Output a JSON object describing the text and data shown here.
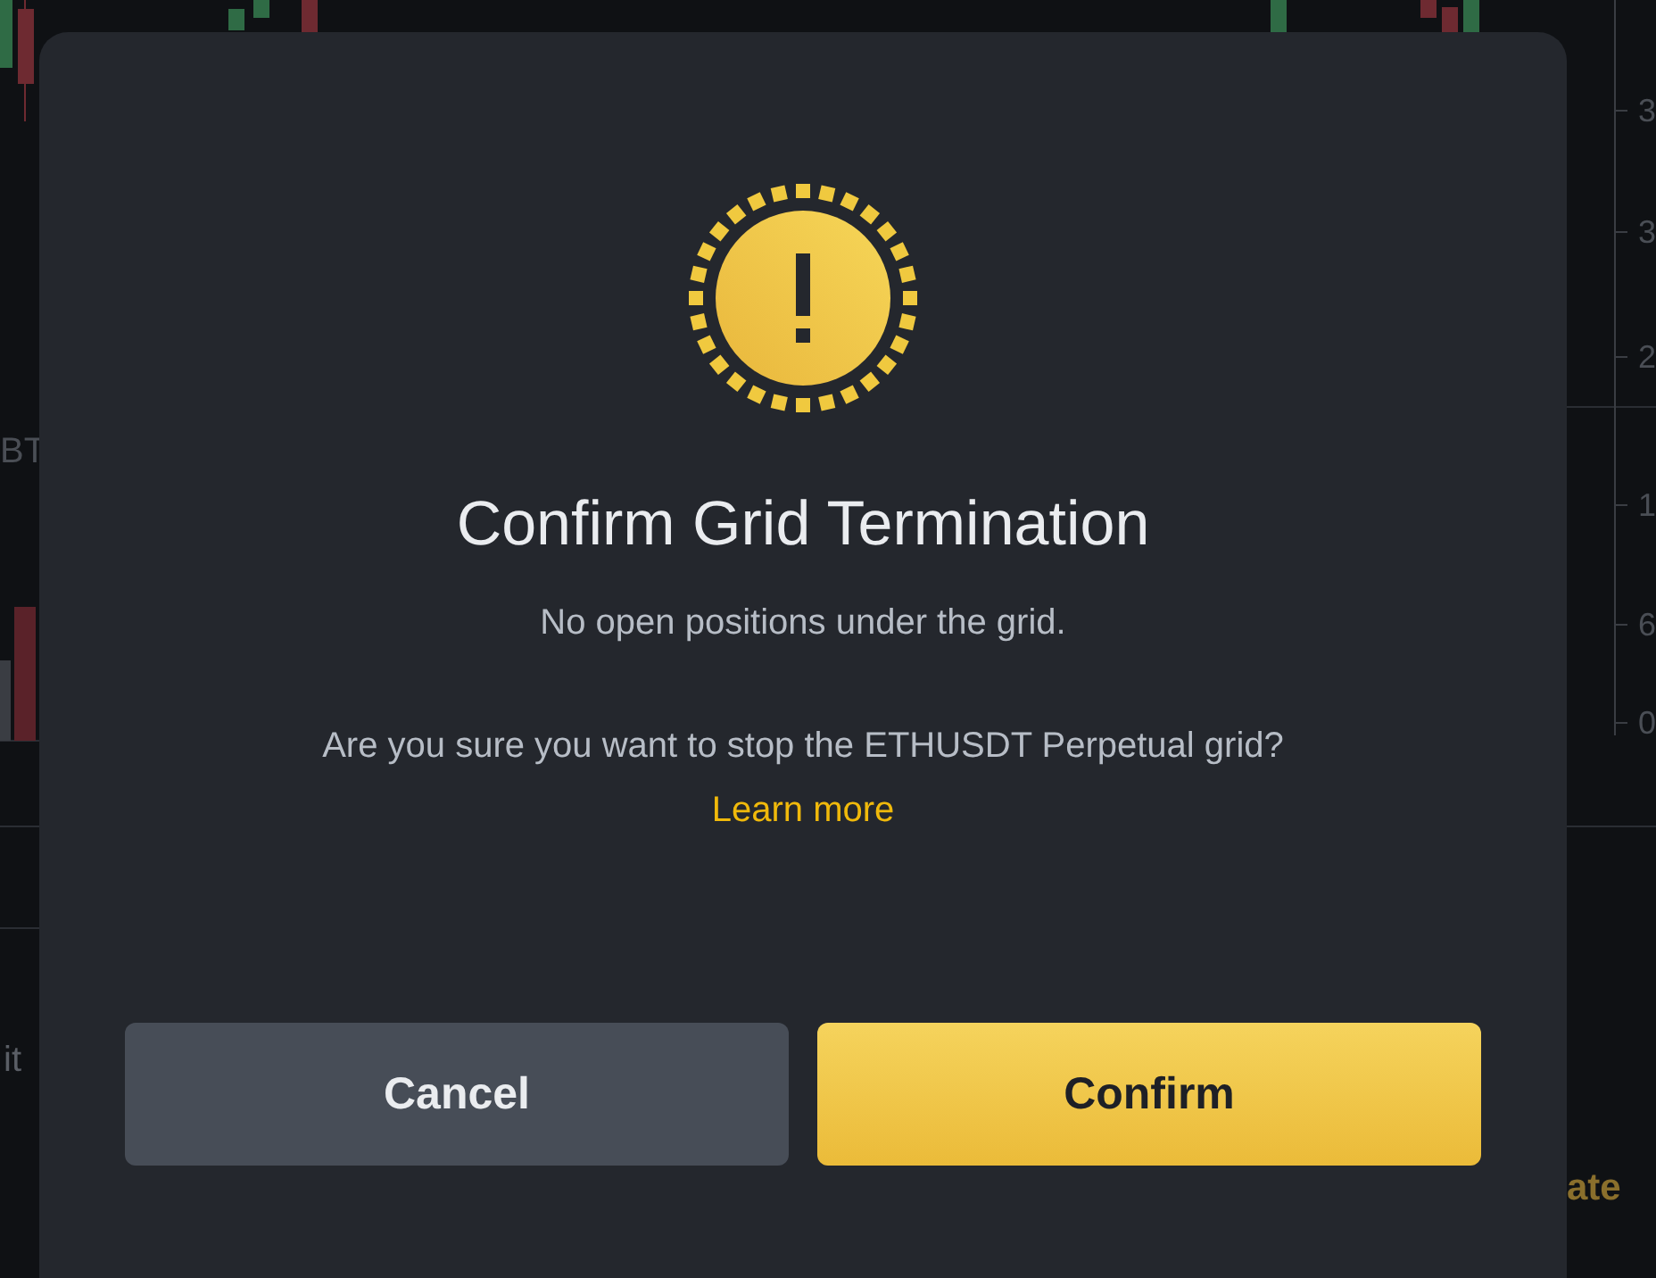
{
  "background": {
    "pair_label": "BT",
    "profit_label": "it",
    "action_label": "ate",
    "axis_labels": [
      "3",
      "3",
      "2",
      "1",
      "6",
      "0"
    ]
  },
  "dialog": {
    "title": "Confirm Grid Termination",
    "message": "No open positions under the grid.",
    "question": "Are you sure you want to stop the ETHUSDT Perpetual grid?",
    "link": "Learn more",
    "buttons": [
      {
        "label": "Cancel",
        "kind": "secondary"
      },
      {
        "label": "Confirm",
        "kind": "primary"
      }
    ]
  }
}
